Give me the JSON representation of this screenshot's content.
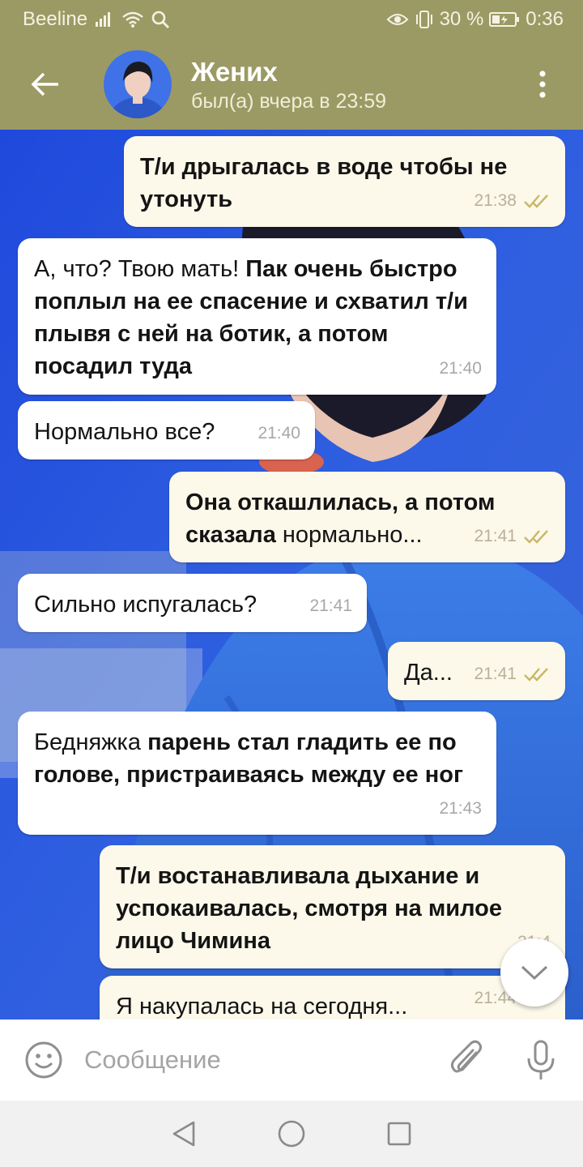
{
  "status_bar": {
    "carrier": "Beeline",
    "battery": "30 %",
    "time": "0:36",
    "icons": [
      "signal-icon",
      "wifi-icon",
      "search-icon",
      "eye-icon",
      "vibrate-icon",
      "battery-icon"
    ]
  },
  "header": {
    "name": "Жених",
    "last_seen": "был(а) вчера в 23:59",
    "icons": [
      "back-arrow-icon",
      "avatar",
      "more-vertical-icon"
    ]
  },
  "messages": [
    {
      "direction": "out",
      "parts": [
        {
          "text": "Т/и дрыгалась в воде чтобы не утонуть",
          "bold": true
        }
      ],
      "time": "21:38",
      "read": true
    },
    {
      "direction": "in",
      "parts": [
        {
          "text": "А, что? Твою мать! ",
          "bold": false
        },
        {
          "text": "Пак очень быстро поплыл на ее спасение и схватил т/и плывя с ней на ботик, а потом посадил туда",
          "bold": true
        }
      ],
      "time": "21:40"
    },
    {
      "direction": "in",
      "parts": [
        {
          "text": "Нормально все?",
          "bold": false
        }
      ],
      "time": "21:40"
    },
    {
      "direction": "out",
      "parts": [
        {
          "text": "Она откашлилась, а потом сказала ",
          "bold": true
        },
        {
          "text": "нормально...",
          "bold": false
        }
      ],
      "time": "21:41",
      "read": true
    },
    {
      "direction": "in",
      "parts": [
        {
          "text": "Сильно испугалась?",
          "bold": false
        }
      ],
      "time": "21:41"
    },
    {
      "direction": "out",
      "parts": [
        {
          "text": "Да...",
          "bold": false
        }
      ],
      "time": "21:41",
      "read": true
    },
    {
      "direction": "in",
      "parts": [
        {
          "text": "Бедняжка ",
          "bold": false
        },
        {
          "text": "парень стал гладить ее по голове, пристраиваясь между ее ног",
          "bold": true
        }
      ],
      "time": "21:43"
    },
    {
      "direction": "out",
      "parts": [
        {
          "text": "Т/и востанавливала дыхание и успокаивалась, смотря на милое лицо Чимина",
          "bold": true
        }
      ],
      "time": "21:4"
    },
    {
      "direction": "out",
      "parts": [
        {
          "text": "Я накупалась на сегодня...",
          "bold": false
        }
      ],
      "time": "21:44",
      "read": true
    }
  ],
  "composer": {
    "placeholder": "Сообщение",
    "icons": [
      "emoji-icon",
      "paperclip-icon",
      "microphone-icon",
      "chevron-down-icon"
    ]
  },
  "navigation": {
    "icons": [
      "back-triangle-icon",
      "home-circle-icon",
      "recents-square-icon"
    ]
  },
  "colors": {
    "header_bg": "#9c9a64",
    "incoming_bubble": "#ffffff",
    "outgoing_bubble": "#fcf8ea",
    "read_check": "#c8b866",
    "chat_background": "#2b4fd6"
  }
}
